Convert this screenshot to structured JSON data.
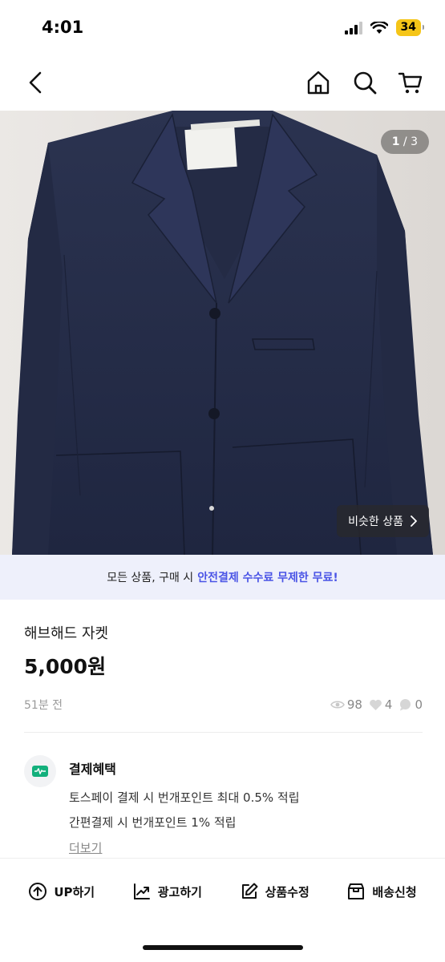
{
  "status_bar": {
    "time": "4:01",
    "battery": "34",
    "battery_color": "#f5c518"
  },
  "nav": {
    "icons": [
      "chevron-left-icon",
      "home-icon",
      "search-icon",
      "cart-icon"
    ]
  },
  "product_image": {
    "counter_current": "1",
    "counter_sep": " / ",
    "counter_total": "3",
    "similar_label": "비슷한 상품"
  },
  "banner": {
    "text": "모든 상품, 구매 시",
    "highlight": "안전결제 수수료 무제한 무료!",
    "highlight_color": "#4a54e6",
    "background": "#eef0fb"
  },
  "product": {
    "title": "해브해드 자켓",
    "price": "5,000원",
    "posted": "51분 전",
    "views": "98",
    "likes": "4",
    "chats": "0"
  },
  "benefit": {
    "title": "결제혜택",
    "line1": "토스페이 결제 시 번개포인트 최대 0.5% 적립",
    "line2": "간편결제 시 번개포인트 1% 적립",
    "more": "더보기",
    "icon_color": "#13b07c"
  },
  "bottom_bar": {
    "up": "UP하기",
    "ad": "광고하기",
    "edit": "상품수정",
    "ship": "배송신청"
  }
}
